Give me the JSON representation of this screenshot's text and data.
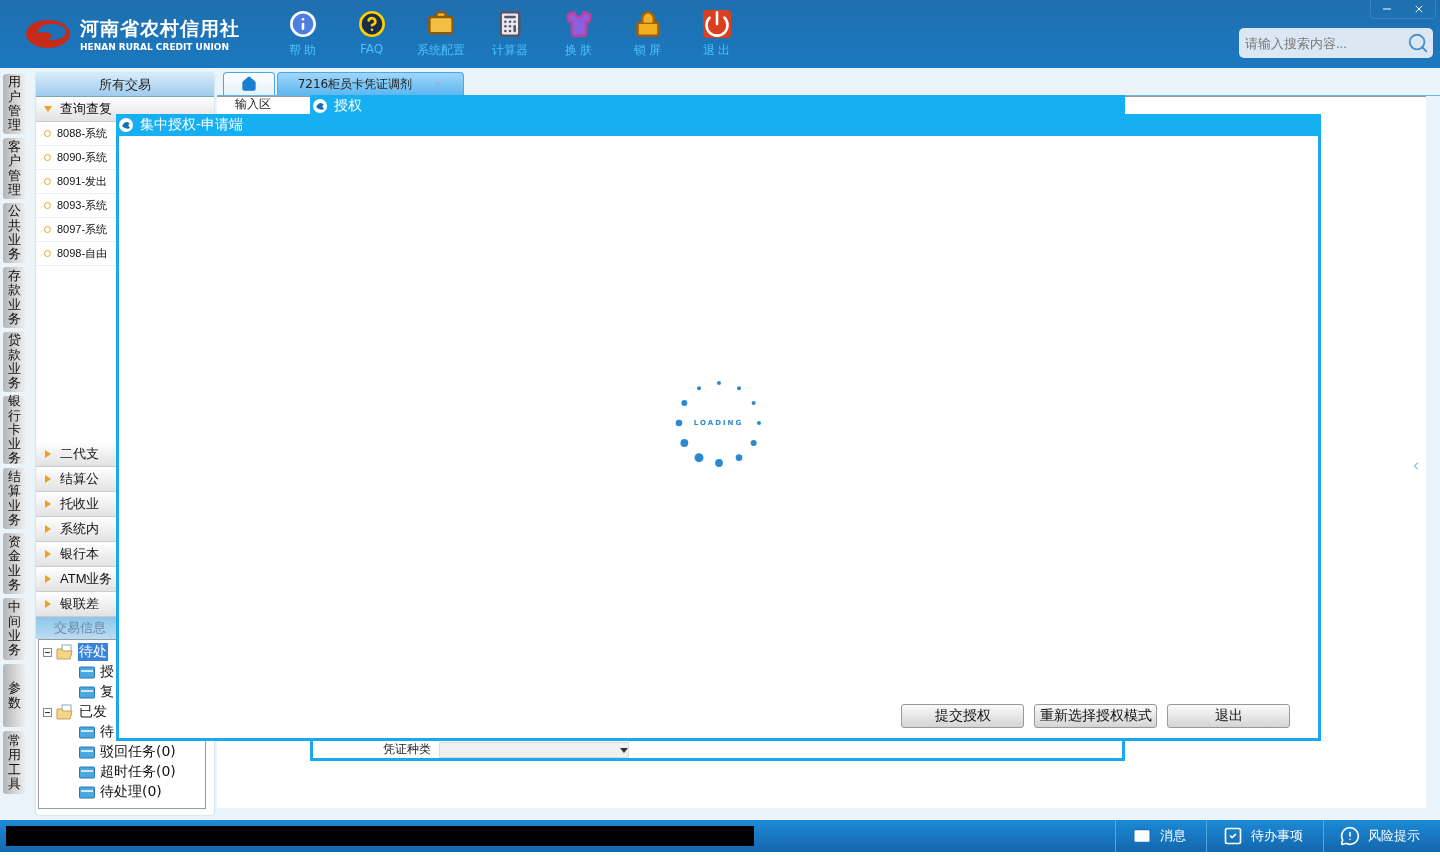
{
  "header": {
    "logo": {
      "name": "河南省农村信用社",
      "subtitle": "HENAN RURAL CREDIT UNION"
    },
    "toolbar": [
      {
        "kind": "info",
        "label": "帮 助"
      },
      {
        "kind": "help",
        "label": "FAQ"
      },
      {
        "kind": "toolbox",
        "label": "系统配置"
      },
      {
        "kind": "calculator",
        "label": "计算器"
      },
      {
        "kind": "skin",
        "label": "换 肤"
      },
      {
        "kind": "lock",
        "label": "锁 屏"
      },
      {
        "kind": "exit",
        "label": "退 出"
      }
    ],
    "search": {
      "placeholder": "请输入搜索内容..."
    }
  },
  "side_tabs": [
    "用户管理",
    "客户管理",
    "公共业务",
    "存款业务",
    "贷款业务",
    "银行卡业务",
    "结算业务",
    "资金业务",
    "中间业务",
    "参数",
    "常用工具"
  ],
  "sidebar": {
    "title": "所有交易",
    "groups": [
      {
        "label": "查询查复",
        "expanded": true,
        "items": [
          "8088-系统",
          "8090-系统",
          "8091-发出",
          "8093-系统",
          "8097-系统",
          "8098-自由"
        ]
      },
      {
        "label": "二代支",
        "expanded": false
      },
      {
        "label": "结算公",
        "expanded": false
      },
      {
        "label": "托收业",
        "expanded": false
      },
      {
        "label": "系统内",
        "expanded": false
      },
      {
        "label": "银行本",
        "expanded": false
      },
      {
        "label": "ATM业务",
        "expanded": false
      },
      {
        "label": "银联差",
        "expanded": false
      }
    ],
    "info_panel": {
      "title": "交易信息",
      "tree": [
        {
          "label": "待处",
          "selected": true,
          "expanded": true,
          "children": [
            {
              "label": "授"
            },
            {
              "label": "复"
            }
          ]
        },
        {
          "label": "已发",
          "selected": false,
          "expanded": true,
          "children": [
            {
              "label": "待"
            },
            {
              "label": "驳回任务(0)"
            },
            {
              "label": "超时任务(0)"
            },
            {
              "label": "待处理(0)"
            }
          ]
        }
      ]
    }
  },
  "tabs": [
    {
      "kind": "home",
      "selected": false
    },
    {
      "kind": "page",
      "label": "7216柜员卡凭证调剂",
      "selected": true
    }
  ],
  "content": {
    "input_area_label": "输入区"
  },
  "auth_dialog": {
    "title": "授权",
    "field_label": "凭证种类"
  },
  "central_dialog": {
    "title": "集中授权-申请端",
    "loading_text": "LOADING",
    "buttons": [
      "提交授权",
      "重新选择授权模式",
      "退出"
    ]
  },
  "status_bar": {
    "items": [
      {
        "kind": "message",
        "label": "消息"
      },
      {
        "kind": "todo",
        "label": "待办事项"
      },
      {
        "kind": "risk",
        "label": "风险提示"
      }
    ]
  }
}
